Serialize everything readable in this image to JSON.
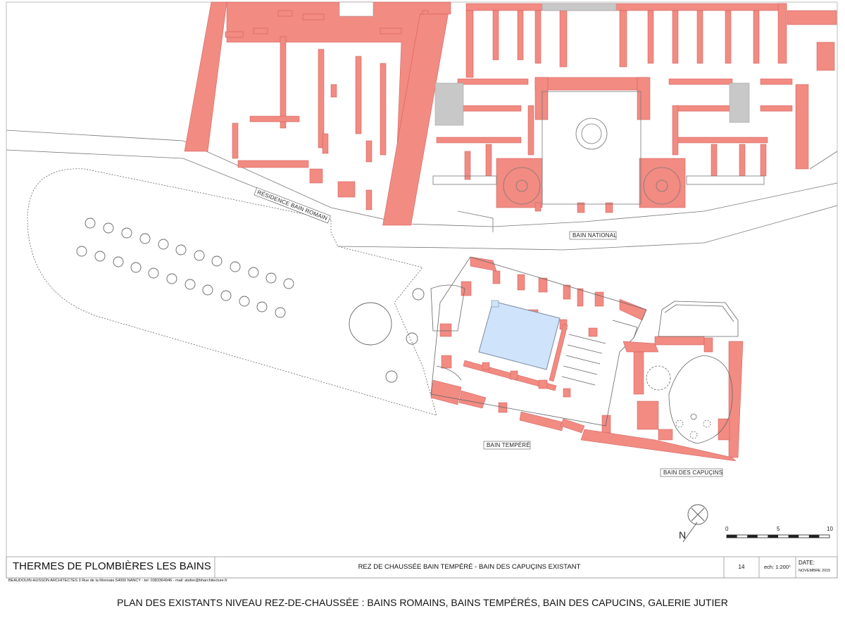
{
  "colors": {
    "wall": "#f28b82",
    "pool": "#cfe3fb",
    "grey": "#c8c8c8",
    "line": "#555555"
  },
  "labels": {
    "residence": "RÉSIDENCE BAIN ROMAIN",
    "national": "BAIN NATIONAL",
    "tempere": "BAIN TEMPÉRÉ",
    "capucins": "BAIN DES CAPUÇINS"
  },
  "north": {
    "letter": "N",
    "icon": "north-arrow-icon"
  },
  "scale_bar": {
    "ticks": [
      "0",
      "5",
      "10"
    ]
  },
  "title_block": {
    "project": "THERMES DE PLOMBIÈRES LES BAINS",
    "drawing": "REZ DE CHAUSSÉE BAIN TEMPÉRÉ - BAIN DES CAPUÇINS EXISTANT",
    "sheet_no": "14",
    "scale": "ech: 1:200°",
    "date_label": "DATE:",
    "date_value": "NOVEMBRE 2015",
    "architect": "BEAUDOUIN-HUSSON ARCHITECTES   3 Rue de la Monnaie 54000 NANCY - tel: 0383364946 - mail: atelier@bharchitecture.fr"
  },
  "caption": "PLAN DES EXISTANTS  NIVEAU REZ-DE-CHAUSSÉE :  BAINS ROMAINS, BAINS TEMPÉRÉS, BAIN DES CAPUCINS, GALERIE JUTIER"
}
